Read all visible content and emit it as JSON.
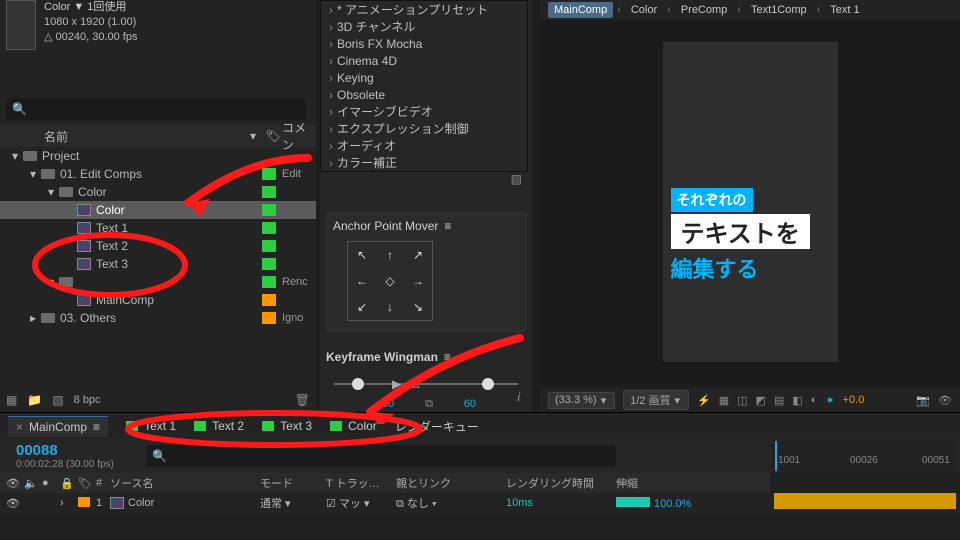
{
  "project_meta": {
    "line1": "Color ▼  1回使用",
    "line2": "1080 x 1920 (1.00)",
    "line3": "△ 00240, 30.00 fps"
  },
  "search_placeholder": "",
  "project_header": {
    "name": "名前",
    "comment": "コメン"
  },
  "tree": [
    {
      "depth": 0,
      "disc": "v",
      "icon": "folder",
      "name": "Project",
      "sw": "",
      "com": ""
    },
    {
      "depth": 1,
      "disc": "v",
      "icon": "folder",
      "name": "01. Edit Comps",
      "sw": "green",
      "com": "Edit"
    },
    {
      "depth": 2,
      "disc": "v",
      "icon": "folder",
      "name": "Color",
      "sw": "green",
      "com": ""
    },
    {
      "depth": 3,
      "disc": "",
      "icon": "comp",
      "name": "Color",
      "sw": "green",
      "com": "",
      "sel": true
    },
    {
      "depth": 3,
      "disc": "",
      "icon": "comp",
      "name": "Text 1",
      "sw": "green",
      "com": ""
    },
    {
      "depth": 3,
      "disc": "",
      "icon": "comp",
      "name": "Text 2",
      "sw": "green",
      "com": ""
    },
    {
      "depth": 3,
      "disc": "",
      "icon": "comp",
      "name": "Text 3",
      "sw": "green",
      "com": ""
    },
    {
      "depth": 2,
      "disc": "v",
      "icon": "folder",
      "name": "",
      "sw": "green",
      "com": "Renc"
    },
    {
      "depth": 3,
      "disc": "",
      "icon": "comp",
      "name": "MainComp",
      "sw": "orange",
      "com": ""
    },
    {
      "depth": 1,
      "disc": ">",
      "icon": "folder",
      "name": "03. Others",
      "sw": "orange",
      "com": "Igno"
    }
  ],
  "bpc": "8 bpc",
  "fx_categories": [
    "* アニメーションプリセット",
    "3D チャンネル",
    "Boris FX Mocha",
    "Cinema 4D",
    "Keying",
    "Obsolete",
    "イマーシブビデオ",
    "エクスプレッション制御",
    "オーディオ",
    "カラー補正"
  ],
  "anchor_title": "Anchor Point Mover",
  "keyframe_title": "Keyframe Wingman",
  "keyframe_val_left": "60",
  "keyframe_val_right": "60",
  "viewer_tabs": [
    "MainComp",
    "Color",
    "PreComp",
    "Text1Comp",
    "Text 1"
  ],
  "preview": {
    "l1": "それぞれの",
    "l2": "テキストを",
    "l3": "編集する"
  },
  "viewer_footer": {
    "zoom": "(33.3 %)",
    "quality": "1/2 画質",
    "exposure": "+0.0"
  },
  "timeline_tabs": [
    {
      "sw": "",
      "label": "MainComp",
      "active": true
    },
    {
      "sw": "green",
      "label": "Text 1"
    },
    {
      "sw": "green",
      "label": "Text 2"
    },
    {
      "sw": "green",
      "label": "Text 3"
    },
    {
      "sw": "green",
      "label": "Color"
    },
    {
      "sw": "",
      "label": "レンダーキュー"
    }
  ],
  "timeline_head": {
    "frame": "00088",
    "sub": "0:00:02;28 (30.00 fps)"
  },
  "timeline_cols": {
    "num": "#",
    "src": "ソース名",
    "mode": "モード",
    "trk": "T トラッ…",
    "parent": "親とリンク",
    "render": "レンダリング時間",
    "stretch": "伸縮"
  },
  "timeline_layer": {
    "idx": "1",
    "name": "Color",
    "mode": "通常",
    "trk": "マッ",
    "parent": "なし",
    "render": "10ms",
    "stretch": "100.0%"
  },
  "ruler": [
    "1001",
    "00026",
    "00051"
  ]
}
